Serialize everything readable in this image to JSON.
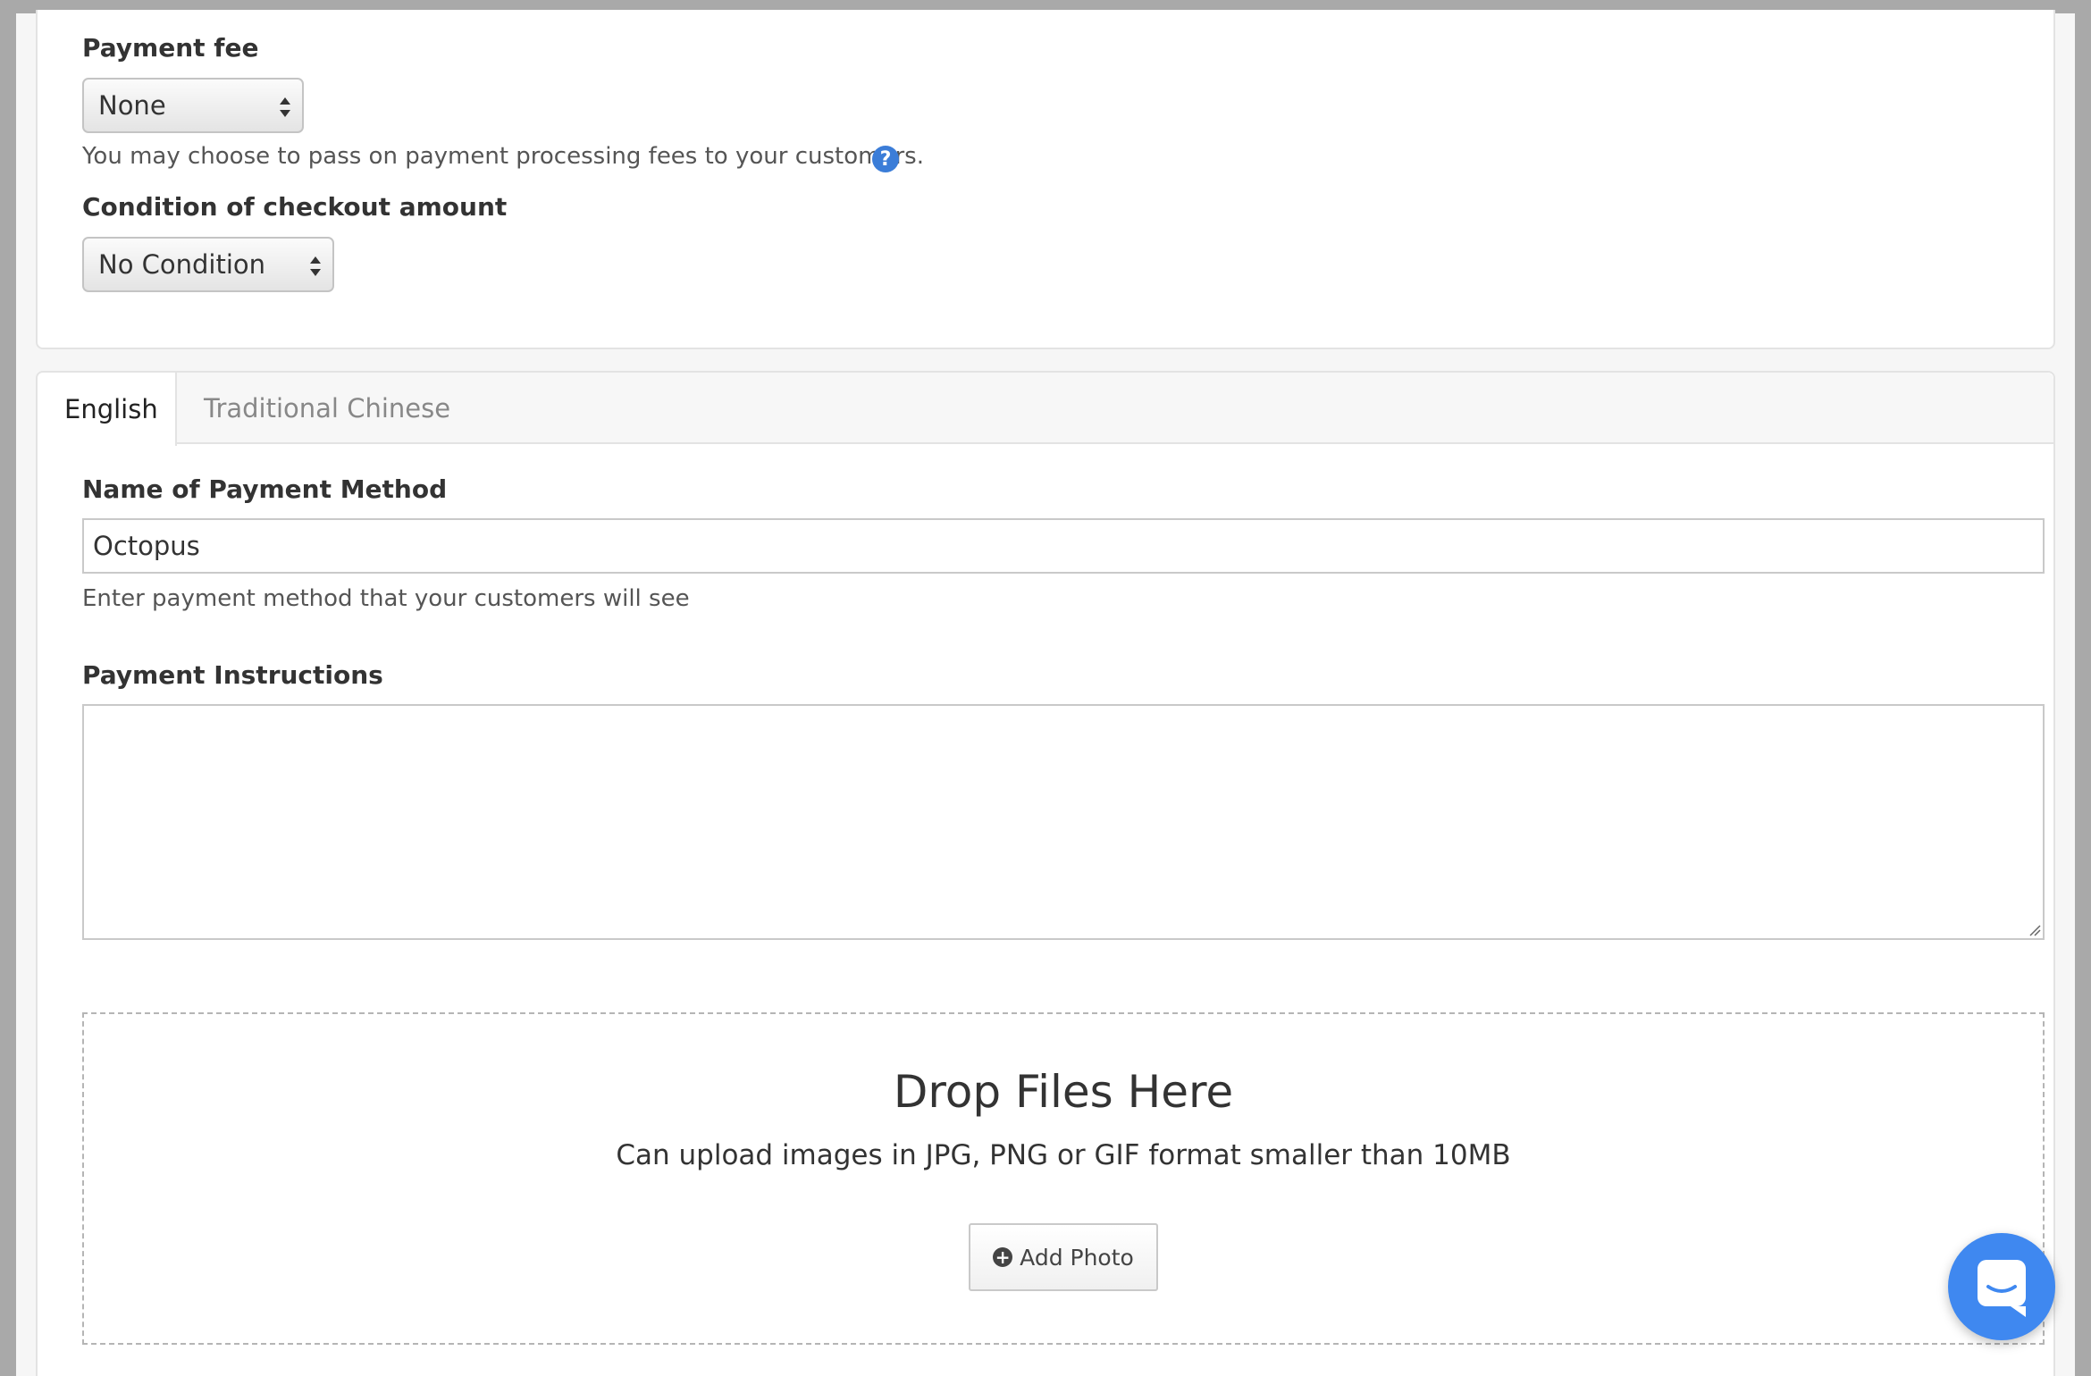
{
  "payment_fee": {
    "label": "Payment fee",
    "selected": "None",
    "hint": "You may choose to pass on payment processing fees to your customers."
  },
  "checkout_condition": {
    "label": "Condition of checkout amount",
    "selected": "No Condition"
  },
  "tabs": [
    {
      "label": "English",
      "active": true
    },
    {
      "label": "Traditional Chinese",
      "active": false
    }
  ],
  "payment_method": {
    "label": "Name of Payment Method",
    "value": "Octopus",
    "hint": "Enter payment method that your customers will see"
  },
  "instructions": {
    "label": "Payment Instructions",
    "value": ""
  },
  "dropzone": {
    "title": "Drop Files Here",
    "subtitle": "Can upload images in JPG, PNG or GIF format smaller than 10MB",
    "button_label": "Add Photo"
  },
  "icons": {
    "help": "question-circle-icon",
    "add": "plus-circle-icon",
    "chat": "chat-bubble-icon"
  },
  "colors": {
    "accent": "#3b7dd8",
    "chat": "#3f88f0"
  }
}
